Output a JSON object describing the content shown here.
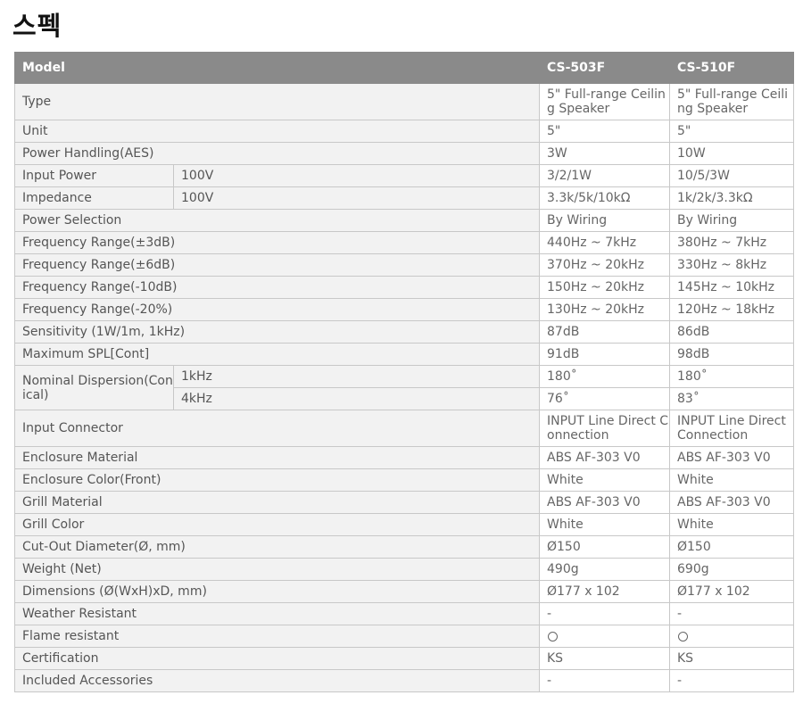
{
  "page_title": "스펙",
  "header": {
    "label": "Model",
    "models": [
      "CS-503F",
      "CS-510F"
    ]
  },
  "rows": {
    "type": {
      "label": "Type",
      "v1": "5\" Full-range Ceiling Speaker",
      "v2": "5\" Full-range Ceiling Speaker"
    },
    "unit": {
      "label": "Unit",
      "v1": "5\"",
      "v2": "5\""
    },
    "power_handling": {
      "label": "Power Handling(AES)",
      "v1": "3W",
      "v2": "10W"
    },
    "input_power": {
      "label": "Input Power",
      "sub": "100V",
      "v1": "3/2/1W",
      "v2": "10/5/3W"
    },
    "impedance": {
      "label": "Impedance",
      "sub": "100V",
      "v1": "3.3k/5k/10kΩ",
      "v2": "1k/2k/3.3kΩ"
    },
    "power_selection": {
      "label": "Power Selection",
      "v1": "By Wiring",
      "v2": "By Wiring"
    },
    "freq_3db": {
      "label": "Frequency Range(±3dB)",
      "v1": "440Hz ~ 7kHz",
      "v2": "380Hz ~ 7kHz"
    },
    "freq_6db": {
      "label": "Frequency Range(±6dB)",
      "v1": "370Hz ~ 20kHz",
      "v2": "330Hz ~ 8kHz"
    },
    "freq_10db": {
      "label": "Frequency Range(-10dB)",
      "v1": "150Hz ~ 20kHz",
      "v2": "145Hz ~ 10kHz"
    },
    "freq_20pct": {
      "label": "Frequency Range(-20%)",
      "v1": "130Hz ~ 20kHz",
      "v2": "120Hz ~ 18kHz"
    },
    "sensitivity": {
      "label": "Sensitivity (1W/1m, 1kHz)",
      "v1": "87dB",
      "v2": "86dB"
    },
    "max_spl": {
      "label": "Maximum SPL[Cont]",
      "v1": "91dB",
      "v2": "98dB"
    },
    "dispersion": {
      "label": "Nominal Dispersion(Conical)",
      "sub1": "1kHz",
      "d1v1": "180˚",
      "d1v2": "180˚",
      "sub2": "4kHz",
      "d2v1": "76˚",
      "d2v2": "83˚"
    },
    "input_connector": {
      "label": "Input Connector",
      "v1": "INPUT Line Direct Connection",
      "v2": "INPUT Line Direct Connection"
    },
    "enclosure_material": {
      "label": "Enclosure Material",
      "v1": "ABS AF-303 V0",
      "v2": "ABS AF-303 V0"
    },
    "enclosure_color": {
      "label": "Enclosure Color(Front)",
      "v1": "White",
      "v2": "White"
    },
    "grill_material": {
      "label": "Grill Material",
      "v1": "ABS AF-303 V0",
      "v2": "ABS AF-303 V0"
    },
    "grill_color": {
      "label": "Grill Color",
      "v1": "White",
      "v2": "White"
    },
    "cutout": {
      "label": "Cut-Out Diameter(Ø, mm)",
      "v1": "Ø150",
      "v2": "Ø150"
    },
    "weight": {
      "label": "Weight (Net)",
      "v1": "490g",
      "v2": "690g"
    },
    "dimensions": {
      "label": "Dimensions (Ø(WxH)xD, mm)",
      "v1": "Ø177 x 102",
      "v2": "Ø177 x 102"
    },
    "weather": {
      "label": "Weather Resistant",
      "v1": "-",
      "v2": "-"
    },
    "flame": {
      "label": "Flame resistant",
      "v1": "circle",
      "v2": "circle"
    },
    "certification": {
      "label": "Certification",
      "v1": "KS",
      "v2": "KS"
    },
    "accessories": {
      "label": "Included Accessories",
      "v1": "-",
      "v2": "-"
    }
  }
}
